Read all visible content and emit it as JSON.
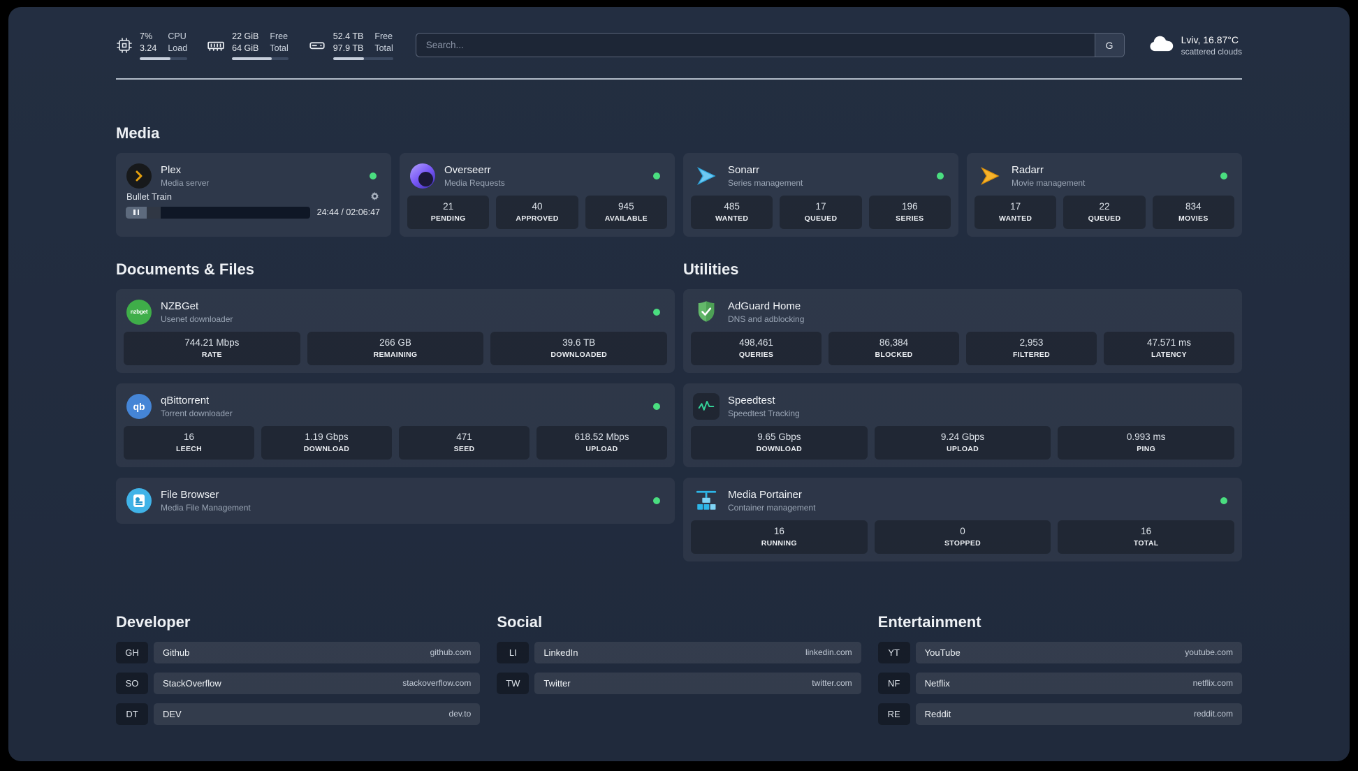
{
  "colors": {
    "status_online": "#4ade80",
    "accent_green": "#34d399"
  },
  "topbar": {
    "metrics": [
      {
        "icon": "cpu-icon",
        "v1": "7%",
        "v2": "3.24",
        "l1": "CPU",
        "l2": "Load",
        "percent": 65
      },
      {
        "icon": "memory-icon",
        "v1": "22 GiB",
        "v2": "64 GiB",
        "l1": "Free",
        "l2": "Total",
        "percent": 70
      },
      {
        "icon": "disk-icon",
        "v1": "52.4 TB",
        "v2": "97.9 TB",
        "l1": "Free",
        "l2": "Total",
        "percent": 52
      }
    ],
    "search": {
      "placeholder": "Search...",
      "provider": "G"
    },
    "weather": {
      "icon": "cloud-icon",
      "location": "Lviv, 16.87°C",
      "condition": "scattered clouds"
    }
  },
  "sections": {
    "media": {
      "title": "Media"
    },
    "documents": {
      "title": "Documents & Files"
    },
    "utilities": {
      "title": "Utilities"
    },
    "developer": {
      "title": "Developer"
    },
    "social": {
      "title": "Social"
    },
    "entertainment": {
      "title": "Entertainment"
    }
  },
  "services": {
    "plex": {
      "icon": "plex-icon",
      "name": "Plex",
      "subtitle": "Media server",
      "now_playing": "Bullet Train",
      "time": "24:44 / 02:06:47",
      "progress_percent": 19
    },
    "overseerr": {
      "icon": "overseerr-icon",
      "name": "Overseerr",
      "subtitle": "Media Requests",
      "stats": [
        {
          "value": "21",
          "label": "PENDING"
        },
        {
          "value": "40",
          "label": "APPROVED"
        },
        {
          "value": "945",
          "label": "AVAILABLE"
        }
      ]
    },
    "sonarr": {
      "icon": "sonarr-icon",
      "name": "Sonarr",
      "subtitle": "Series management",
      "stats": [
        {
          "value": "485",
          "label": "WANTED"
        },
        {
          "value": "17",
          "label": "QUEUED"
        },
        {
          "value": "196",
          "label": "SERIES"
        }
      ]
    },
    "radarr": {
      "icon": "radarr-icon",
      "name": "Radarr",
      "subtitle": "Movie management",
      "stats": [
        {
          "value": "17",
          "label": "WANTED"
        },
        {
          "value": "22",
          "label": "QUEUED"
        },
        {
          "value": "834",
          "label": "MOVIES"
        }
      ]
    },
    "nzbget": {
      "icon": "nzbget-icon",
      "icon_text": "nzbget",
      "name": "NZBGet",
      "subtitle": "Usenet downloader",
      "stats": [
        {
          "value": "744.21 Mbps",
          "label": "RATE"
        },
        {
          "value": "266 GB",
          "label": "REMAINING"
        },
        {
          "value": "39.6 TB",
          "label": "DOWNLOADED"
        }
      ]
    },
    "qbittorrent": {
      "icon": "qbittorrent-icon",
      "icon_text": "qb",
      "name": "qBittorrent",
      "subtitle": "Torrent downloader",
      "stats": [
        {
          "value": "16",
          "label": "LEECH"
        },
        {
          "value": "1.19 Gbps",
          "label": "DOWNLOAD"
        },
        {
          "value": "471",
          "label": "SEED"
        },
        {
          "value": "618.52 Mbps",
          "label": "UPLOAD"
        }
      ]
    },
    "filebrowser": {
      "icon": "filebrowser-icon",
      "name": "File Browser",
      "subtitle": "Media File Management",
      "stats": []
    },
    "adguard": {
      "icon": "adguard-icon",
      "name": "AdGuard Home",
      "subtitle": "DNS and adblocking",
      "stats": [
        {
          "value": "498,461",
          "label": "QUERIES"
        },
        {
          "value": "86,384",
          "label": "BLOCKED"
        },
        {
          "value": "2,953",
          "label": "FILTERED"
        },
        {
          "value": "47.571 ms",
          "label": "LATENCY"
        }
      ]
    },
    "speedtest": {
      "icon": "speedtest-icon",
      "name": "Speedtest",
      "subtitle": "Speedtest Tracking",
      "stats": [
        {
          "value": "9.65 Gbps",
          "label": "DOWNLOAD"
        },
        {
          "value": "9.24 Gbps",
          "label": "UPLOAD"
        },
        {
          "value": "0.993 ms",
          "label": "PING"
        }
      ]
    },
    "portainer": {
      "icon": "portainer-icon",
      "name": "Media Portainer",
      "subtitle": "Container management",
      "stats": [
        {
          "value": "16",
          "label": "RUNNING"
        },
        {
          "value": "0",
          "label": "STOPPED"
        },
        {
          "value": "16",
          "label": "TOTAL"
        }
      ]
    }
  },
  "bookmarks": {
    "developer": [
      {
        "abbr": "GH",
        "name": "Github",
        "url": "github.com"
      },
      {
        "abbr": "SO",
        "name": "StackOverflow",
        "url": "stackoverflow.com"
      },
      {
        "abbr": "DT",
        "name": "DEV",
        "url": "dev.to"
      }
    ],
    "social": [
      {
        "abbr": "LI",
        "name": "LinkedIn",
        "url": "linkedin.com"
      },
      {
        "abbr": "TW",
        "name": "Twitter",
        "url": "twitter.com"
      }
    ],
    "entertainment": [
      {
        "abbr": "YT",
        "name": "YouTube",
        "url": "youtube.com"
      },
      {
        "abbr": "NF",
        "name": "Netflix",
        "url": "netflix.com"
      },
      {
        "abbr": "RE",
        "name": "Reddit",
        "url": "reddit.com"
      }
    ]
  }
}
